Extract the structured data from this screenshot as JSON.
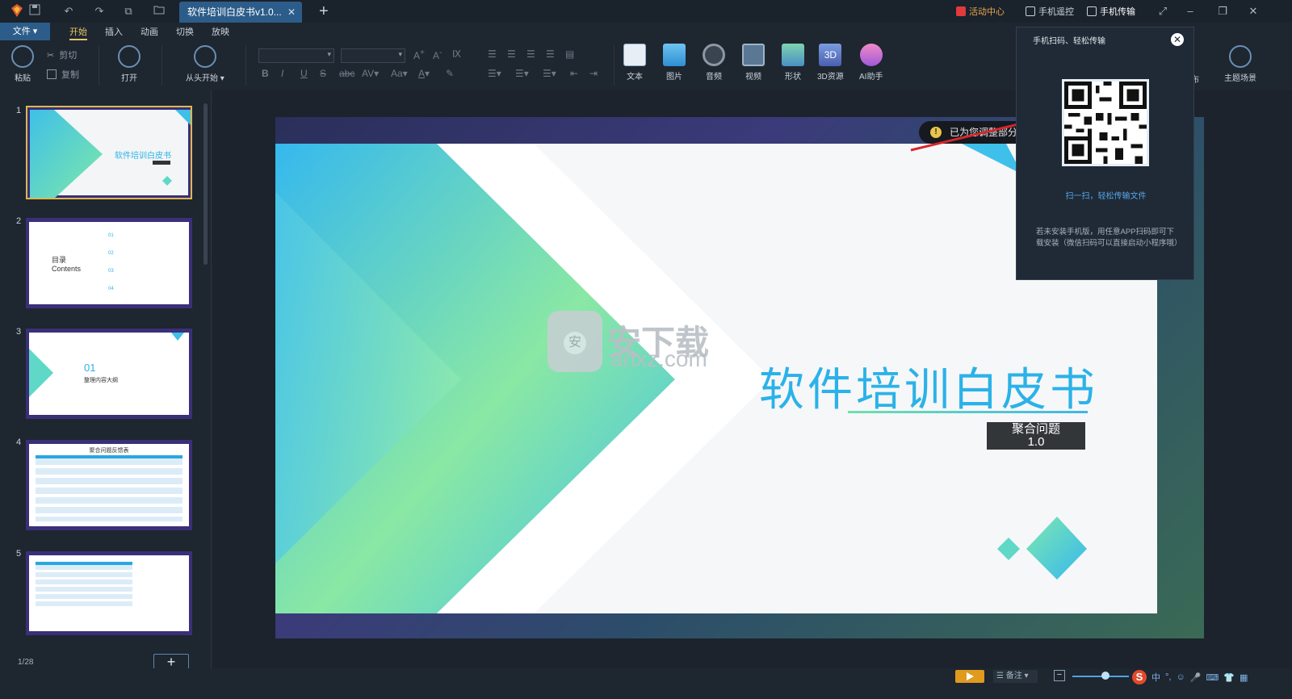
{
  "titlebar": {
    "doc_tab": "软件培训白皮书v1.0...",
    "activity_center": "活动中心",
    "phone_remote": "手机遥控",
    "phone_transfer": "手机传输"
  },
  "menubar": {
    "file": "文件",
    "items": [
      "开始",
      "插入",
      "动画",
      "切换",
      "放映"
    ]
  },
  "ribbon": {
    "paste": "粘贴",
    "cut": "剪切",
    "copy": "复制",
    "open": "打开",
    "from_start": "从头开始",
    "insert_items": [
      "文本",
      "图片",
      "音频",
      "视频",
      "形状",
      "3D资源",
      "AI助手"
    ],
    "theme_scene": "主题场景",
    "hidden_partial": "布"
  },
  "thumbnails": [
    {
      "num": "1",
      "title": "软件培训白皮书"
    },
    {
      "num": "2",
      "title": "目录",
      "subtitle": "Contents",
      "items": [
        "01",
        "02",
        "03",
        "04"
      ]
    },
    {
      "num": "3",
      "title": "01",
      "subtitle": "整理内容大纲"
    },
    {
      "num": "4",
      "title": "聚合问题反馈表"
    },
    {
      "num": "5",
      "title": ""
    }
  ],
  "page_counter": "1/28",
  "slide": {
    "title": "软件培训白皮书",
    "subtitle_line1": "聚合问题",
    "subtitle_line2": "1.0",
    "notice": "已为您调整部分"
  },
  "watermark": {
    "text_cn": "安下载",
    "text_en": "anxz.com",
    "badge": "安"
  },
  "popup": {
    "title": "手机扫码、轻松传输",
    "scan_text": "扫一扫，轻松传输文件",
    "note": "若未安装手机版，用任意APP扫码即可下载安装（微信扫码可以直接启动小程序哦）"
  },
  "statusbar": {
    "notes": "备注",
    "ime_lang": "中"
  },
  "colors": {
    "accent_tab": "#2c5d8a",
    "active_menu": "#e6c46a",
    "slide_title": "#2bb2e8",
    "arrow": "#d8262c"
  }
}
